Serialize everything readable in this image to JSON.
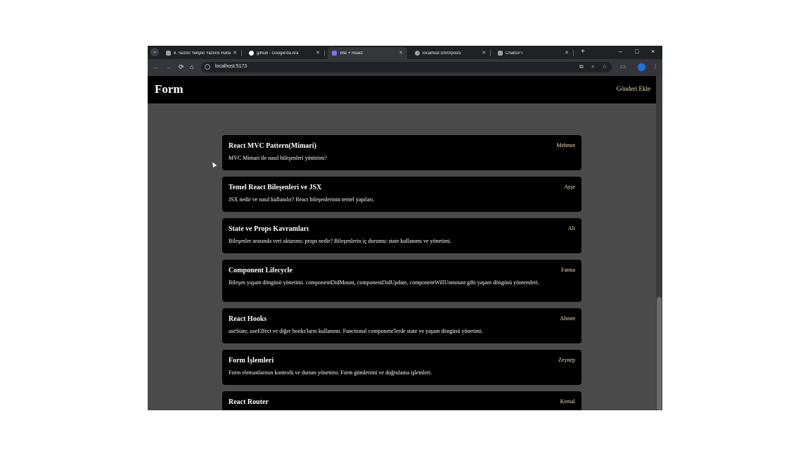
{
  "browser": {
    "tabs": [
      {
        "label": "8. Sezon Yetiştin Yazılım Hafta",
        "favicon_color": "#9aa0a6"
      },
      {
        "label": "github - Google'da Ara",
        "favicon_color": "#ffffff"
      },
      {
        "label": "Vite + React",
        "favicon_color": "#8a6cf7"
      },
      {
        "label": "localhost:3000/posts",
        "favicon_color": "#9aa0a6"
      },
      {
        "label": "ChatGPT",
        "favicon_color": "#9aa0a6"
      }
    ],
    "new_tab": "+",
    "minimize": "–",
    "maximize": "□",
    "close": "×",
    "address": "localhost:5173"
  },
  "header": {
    "brand": "Form",
    "add_post": "Gönderi Ekle"
  },
  "posts": [
    {
      "title": "React MVC Pattern(Mimari)",
      "author": "Mehmet",
      "body": "MVC Mimari ile nasıl bileşenleri yöntirim?"
    },
    {
      "title": "Temel React Bileşenleri ve JSX",
      "author": "Ayşe",
      "body": "JSX nedir ve nasıl kullanılır? React bileşenlerinin temel yapıları."
    },
    {
      "title": "State ve Props Kavramları",
      "author": "Ali",
      "body": "Bileşenler arasında veri aktarımı: props nedir? Bileşenlerin iç durumu: state kullanımı ve yönetimi."
    },
    {
      "title": "Component Lifecycle",
      "author": "Fatma",
      "body": "Bileşen yaşam döngüsü yönetimi. componentDidMount, componentDidUpdate, componentWillUnmount gibi yaşam döngüsü yöntemleri."
    },
    {
      "title": "React Hooks",
      "author": "Ahmet",
      "body": "useState, useEffect ve diğer hooks'ların kullanımı. Functional component'lerde state ve yaşam döngüsü yönetimi."
    },
    {
      "title": "Form İşlemleri",
      "author": "Zeynep",
      "body": "Form elemanlarının kontrolü ve durum yönetimi. Form gönderimi ve doğrulama işlemleri."
    },
    {
      "title": "React Router",
      "author": "Kemal",
      "body": ""
    }
  ]
}
